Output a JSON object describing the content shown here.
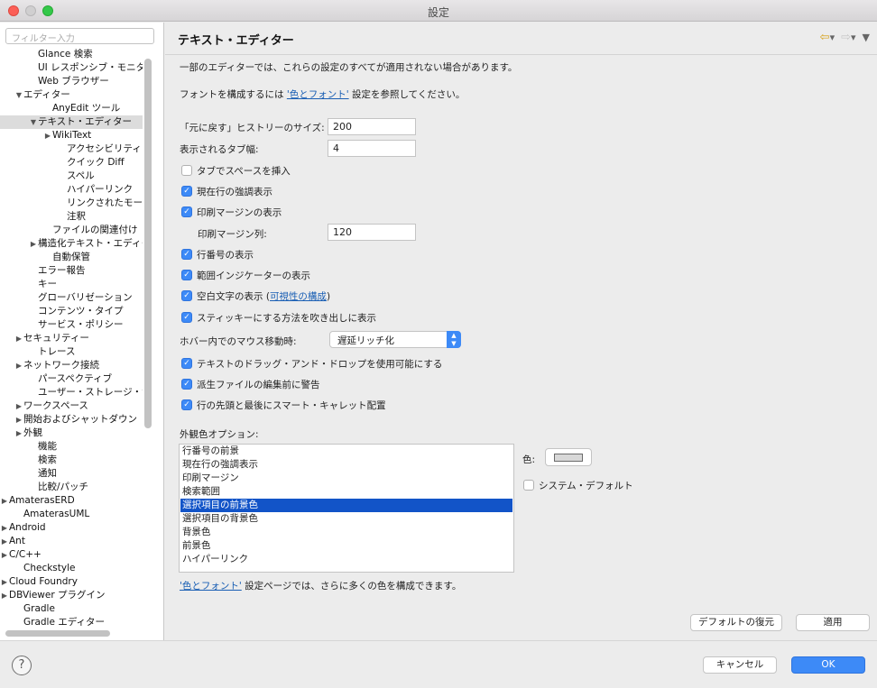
{
  "window": {
    "title": "設定"
  },
  "sidebar": {
    "filter_placeholder": "フィルター入力",
    "items": [
      {
        "label": "Glance 検索",
        "indent": 2,
        "toggle": ""
      },
      {
        "label": "UI レスポンシブ・モニタ",
        "indent": 2,
        "toggle": ""
      },
      {
        "label": "Web ブラウザー",
        "indent": 2,
        "toggle": ""
      },
      {
        "label": "エディター",
        "indent": 1,
        "toggle": "▼"
      },
      {
        "label": "AnyEdit ツール",
        "indent": 3,
        "toggle": ""
      },
      {
        "label": "テキスト・エディター",
        "indent": 2,
        "toggle": "▼",
        "selected": true
      },
      {
        "label": "WikiText",
        "indent": 3,
        "toggle": "▶"
      },
      {
        "label": "アクセシビリティ",
        "indent": 4,
        "toggle": ""
      },
      {
        "label": "クイック Diff",
        "indent": 4,
        "toggle": ""
      },
      {
        "label": "スペル",
        "indent": 4,
        "toggle": ""
      },
      {
        "label": "ハイパーリンク",
        "indent": 4,
        "toggle": ""
      },
      {
        "label": "リンクされたモード",
        "indent": 4,
        "toggle": ""
      },
      {
        "label": "注釈",
        "indent": 4,
        "toggle": ""
      },
      {
        "label": "ファイルの関連付け",
        "indent": 3,
        "toggle": ""
      },
      {
        "label": "構造化テキスト・エディター",
        "indent": 2,
        "toggle": "▶"
      },
      {
        "label": "自動保管",
        "indent": 3,
        "toggle": ""
      },
      {
        "label": "エラー報告",
        "indent": 2,
        "toggle": ""
      },
      {
        "label": "キー",
        "indent": 2,
        "toggle": ""
      },
      {
        "label": "グローバリゼーション",
        "indent": 2,
        "toggle": ""
      },
      {
        "label": "コンテンツ・タイプ",
        "indent": 2,
        "toggle": ""
      },
      {
        "label": "サービス・ポリシー",
        "indent": 2,
        "toggle": ""
      },
      {
        "label": "セキュリティー",
        "indent": 1,
        "toggle": "▶"
      },
      {
        "label": "トレース",
        "indent": 2,
        "toggle": ""
      },
      {
        "label": "ネットワーク接続",
        "indent": 1,
        "toggle": "▶"
      },
      {
        "label": "パースペクティブ",
        "indent": 2,
        "toggle": ""
      },
      {
        "label": "ユーザー・ストレージ・サービス",
        "indent": 2,
        "toggle": ""
      },
      {
        "label": "ワークスペース",
        "indent": 1,
        "toggle": "▶"
      },
      {
        "label": "開始およびシャットダウン",
        "indent": 1,
        "toggle": "▶"
      },
      {
        "label": "外観",
        "indent": 1,
        "toggle": "▶"
      },
      {
        "label": "機能",
        "indent": 2,
        "toggle": ""
      },
      {
        "label": "検索",
        "indent": 2,
        "toggle": ""
      },
      {
        "label": "通知",
        "indent": 2,
        "toggle": ""
      },
      {
        "label": "比較/パッチ",
        "indent": 2,
        "toggle": ""
      },
      {
        "label": "AmaterasERD",
        "indent": 0,
        "toggle": "▶"
      },
      {
        "label": "AmaterasUML",
        "indent": 1,
        "toggle": ""
      },
      {
        "label": "Android",
        "indent": 0,
        "toggle": "▶"
      },
      {
        "label": "Ant",
        "indent": 0,
        "toggle": "▶"
      },
      {
        "label": "C/C++",
        "indent": 0,
        "toggle": "▶"
      },
      {
        "label": "Checkstyle",
        "indent": 1,
        "toggle": ""
      },
      {
        "label": "Cloud Foundry",
        "indent": 0,
        "toggle": "▶"
      },
      {
        "label": "DBViewer プラグイン",
        "indent": 0,
        "toggle": "▶"
      },
      {
        "label": "Gradle",
        "indent": 1,
        "toggle": ""
      },
      {
        "label": "Gradle エディター",
        "indent": 1,
        "toggle": ""
      }
    ]
  },
  "main": {
    "title": "テキスト・エディター",
    "description": "一部のエディターでは、これらの設定のすべてが適用されない場合があります。",
    "font_line": {
      "prefix": "フォントを構成するには ",
      "link": "'色とフォント'",
      "suffix": " 設定を参照してください。"
    },
    "undo_history": {
      "label": "「元に戻す」ヒストリーのサイズ:",
      "value": "200"
    },
    "tab_width": {
      "label": "表示されるタブ幅:",
      "value": "4"
    },
    "checkboxes_top": [
      {
        "label": "タブでスペースを挿入",
        "checked": false
      },
      {
        "label": "現在行の強調表示",
        "checked": true
      },
      {
        "label": "印刷マージンの表示",
        "checked": true
      }
    ],
    "print_margin": {
      "label": "印刷マージン列:",
      "value": "120"
    },
    "checkboxes_mid": [
      {
        "label": "行番号の表示",
        "checked": true
      },
      {
        "label": "範囲インジケーターの表示",
        "checked": true
      },
      {
        "label": "空白文字の表示",
        "checked": true,
        "link": "可視性の構成"
      },
      {
        "label": "スティッキーにする方法を吹き出しに表示",
        "checked": true
      }
    ],
    "hover": {
      "label": "ホバー内でのマウス移動時:",
      "value": "遅延リッチ化"
    },
    "checkboxes_bottom": [
      {
        "label": "テキストのドラッグ・アンド・ドロップを使用可能にする",
        "checked": true
      },
      {
        "label": "派生ファイルの編集前に警告",
        "checked": true
      },
      {
        "label": "行の先頭と最後にスマート・キャレット配置",
        "checked": true
      }
    ],
    "appearance": {
      "label": "外観色オプション:",
      "items": [
        "行番号の前景",
        "現在行の強調表示",
        "印刷マージン",
        "検索範囲",
        "選択項目の前景色",
        "選択項目の背景色",
        "背景色",
        "前景色",
        "ハイパーリンク"
      ],
      "selected_index": 4,
      "color_label": "色:",
      "system_default_label": "システム・デフォルト",
      "system_default_checked": false,
      "swatch_color": "#d8d8d8"
    },
    "footer_line": {
      "link": "'色とフォント'",
      "suffix": " 設定ページでは、さらに多くの色を構成できます。"
    },
    "restore_defaults": "デフォルトの復元",
    "apply": "適用"
  },
  "bottom": {
    "cancel": "キャンセル",
    "ok": "OK"
  },
  "colors": {
    "accent": "#3d8af7",
    "selection": "#1254c8",
    "link": "#1a5fb4"
  }
}
